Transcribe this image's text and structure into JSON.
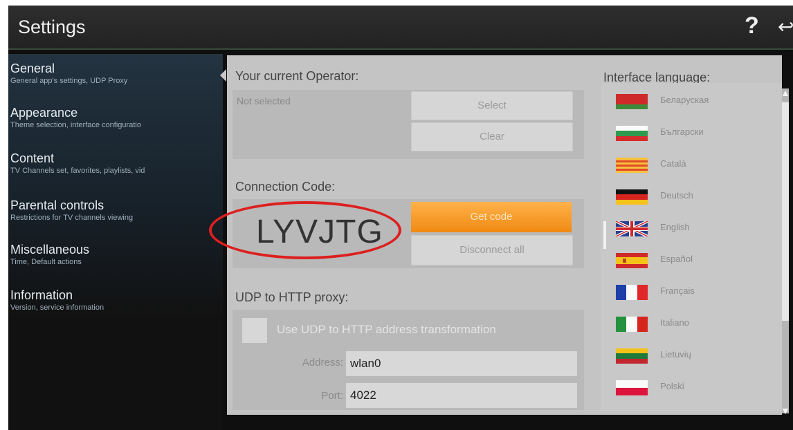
{
  "app": {
    "title": "Settings"
  },
  "header": {
    "help_glyph": "?",
    "back_glyph": "↩"
  },
  "sidebar": {
    "items": [
      {
        "label": "General",
        "sub": "General app's settings, UDP Proxy"
      },
      {
        "label": "Appearance",
        "sub": "Theme selection, interface configuratio"
      },
      {
        "label": "Content",
        "sub": "TV Channels set, favorites, playlists, vid"
      },
      {
        "label": "Parental controls",
        "sub": "Restrictions for TV channels viewing"
      },
      {
        "label": "Miscellaneous",
        "sub": "Time, Default actions"
      },
      {
        "label": "Information",
        "sub": "Version, service information"
      }
    ],
    "selected": "General"
  },
  "operator": {
    "label": "Your current Operator:",
    "value": "Not selected",
    "select_label": "Select",
    "clear_label": "Clear"
  },
  "connection": {
    "label": "Connection Code:",
    "code": "LYVJTG",
    "get_code_label": "Get code",
    "disconnect_label": "Disconnect all",
    "highlight_color": "#dd1f1f",
    "accent_color": "#f59a23"
  },
  "proxy": {
    "label": "UDP to HTTP proxy:",
    "checkbox_label": "Use UDP to HTTP address transformation",
    "checkbox_checked": false,
    "address_label": "Address:",
    "address_value": "wlan0",
    "port_label": "Port:",
    "port_value": "4022"
  },
  "language": {
    "label": "Interface language:",
    "items": [
      {
        "name": "Беларуская",
        "flag": "belarus"
      },
      {
        "name": "Български",
        "flag": "bulgaria"
      },
      {
        "name": "Català",
        "flag": "catalonia"
      },
      {
        "name": "Deutsch",
        "flag": "germany"
      },
      {
        "name": "English",
        "flag": "uk"
      },
      {
        "name": "Español",
        "flag": "spain"
      },
      {
        "name": "Français",
        "flag": "france"
      },
      {
        "name": "Italiano",
        "flag": "italy"
      },
      {
        "name": "Lietuvių",
        "flag": "lithuania"
      },
      {
        "name": "Polski",
        "flag": "poland"
      }
    ],
    "selected": "English"
  }
}
